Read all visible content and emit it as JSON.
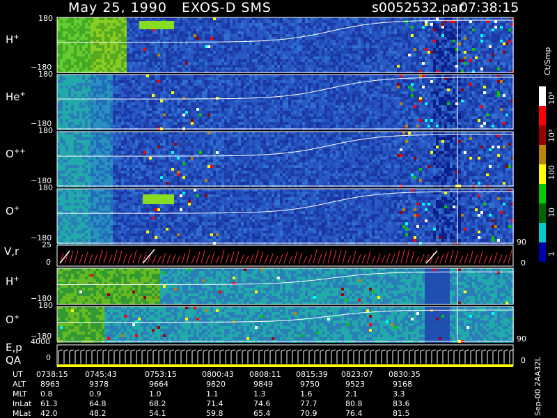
{
  "header": {
    "title": "May 25, 1990   EXOS-D SMS",
    "file": "s0052532.par",
    "time": "07:38:15"
  },
  "colorbar": {
    "units_label": "Ct/Smp",
    "tick_labels": [
      "10⁴",
      "10³",
      "100",
      "10",
      "1"
    ],
    "stops": [
      "#ffffff",
      "#ff0000",
      "#990000",
      "#b8860b",
      "#ffff00",
      "#00cc00",
      "#006600",
      "#00cccc",
      "#0000aa"
    ]
  },
  "footer_tag": "Sep-00  2AA32L",
  "chart_data": [
    {
      "type": "heatmap",
      "panel_label": "H+",
      "species": "H",
      "charge": "+",
      "y_top": "180",
      "y_bottom": "−180"
    },
    {
      "type": "heatmap",
      "panel_label": "He+",
      "species": "He",
      "charge": "+",
      "y_top": "180",
      "y_bottom": "−180"
    },
    {
      "type": "heatmap",
      "panel_label": "O++",
      "species": "O",
      "charge": "++",
      "y_top": "180",
      "y_bottom": "−180"
    },
    {
      "type": "heatmap",
      "panel_label": "O+",
      "species": "O",
      "charge": "+",
      "y_top": "180",
      "y_bottom": "−180",
      "right_tick": "90"
    },
    {
      "type": "line",
      "panel_label": "V,r",
      "y_top": "25",
      "y_bottom": "0",
      "right_tick": "0"
    },
    {
      "type": "heatmap",
      "panel_label": "H+",
      "species": "H",
      "charge": "+",
      "y_bottom": "−180"
    },
    {
      "type": "heatmap",
      "panel_label": "O+",
      "species": "O",
      "charge": "+",
      "y_top": "180",
      "y_bottom": "−180",
      "right_tick": "90"
    },
    {
      "type": "line",
      "panel_label": "E,p",
      "panel_label2": "QA",
      "y_top": "4000",
      "y_bottom": "0",
      "right_tick": "0"
    }
  ],
  "ephemeris": {
    "row_labels": [
      "UT",
      "ALT",
      "MLT",
      "InLat",
      "MLat"
    ],
    "columns": [
      [
        "0738:15",
        "8963",
        "0.8",
        "61.3",
        "42.0"
      ],
      [
        "0745:43",
        "9378",
        "0.9",
        "64.8",
        "48.2"
      ],
      [
        "0753:15",
        "9664",
        "1.0",
        "68.2",
        "54.1"
      ],
      [
        "0800:43",
        "9820",
        "1.1",
        "71.4",
        "59.8"
      ],
      [
        "0808:11",
        "9849",
        "1.3",
        "74.6",
        "65.4"
      ],
      [
        "0815:39",
        "9750",
        "1.6",
        "77.7",
        "70.9"
      ],
      [
        "0823:07",
        "9523",
        "2.1",
        "80.8",
        "76.4"
      ],
      [
        "0830:35",
        "9168",
        "3.3",
        "83.6",
        "81.5"
      ]
    ]
  }
}
